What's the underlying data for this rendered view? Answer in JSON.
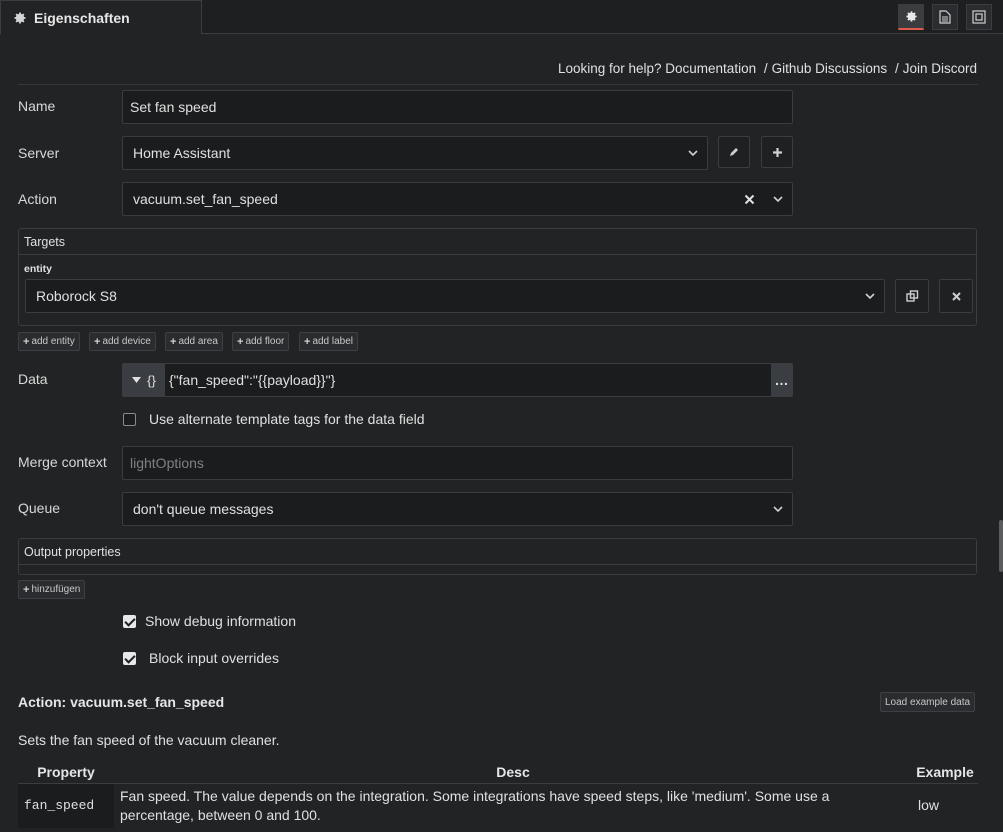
{
  "header": {
    "tab_title": "Eigenschaften",
    "icons": [
      "gear-icon",
      "document-icon",
      "frame-icon"
    ]
  },
  "help": {
    "prefix": "Looking for help?",
    "links": [
      "Documentation",
      "Github Discussions",
      "Join Discord"
    ],
    "separator": "/"
  },
  "form": {
    "name": {
      "label": "Name",
      "value": "Set fan speed"
    },
    "server": {
      "label": "Server",
      "value": "Home Assistant"
    },
    "action": {
      "label": "Action",
      "value": "vacuum.set_fan_speed"
    },
    "targets": {
      "title": "Targets",
      "entity_label": "entity",
      "entity_value": "Roborock S8",
      "add_buttons": [
        "add entity",
        "add device",
        "add area",
        "add floor",
        "add label"
      ]
    },
    "data": {
      "label": "Data",
      "type_glyph": "{}",
      "value": "{\"fan_speed\":\"{{payload}}\"}",
      "more": "…"
    },
    "alt_template": {
      "label": "Use alternate template tags for the data field",
      "checked": false
    },
    "merge_context": {
      "label": "Merge context",
      "placeholder": "lightOptions"
    },
    "queue": {
      "label": "Queue",
      "value": "don't queue messages"
    },
    "output_properties": {
      "title": "Output properties",
      "add_label": "hinzufügen"
    },
    "show_debug": {
      "label": "Show debug information",
      "checked": true
    },
    "block_overrides": {
      "label": "Block input overrides",
      "checked": true
    }
  },
  "docs": {
    "title": "Action: vacuum.set_fan_speed",
    "load_example": "Load example data",
    "description": "Sets the fan speed of the vacuum cleaner.",
    "columns": [
      "Property",
      "Desc",
      "Example"
    ],
    "rows": [
      {
        "property": "fan_speed",
        "desc": "Fan speed. The value depends on the integration. Some integrations have speed steps, like 'medium'. Some use a percentage, between 0 and 100.",
        "example": "low"
      }
    ]
  },
  "colors": {
    "background": "#212325",
    "accent": "#e05a4a"
  }
}
